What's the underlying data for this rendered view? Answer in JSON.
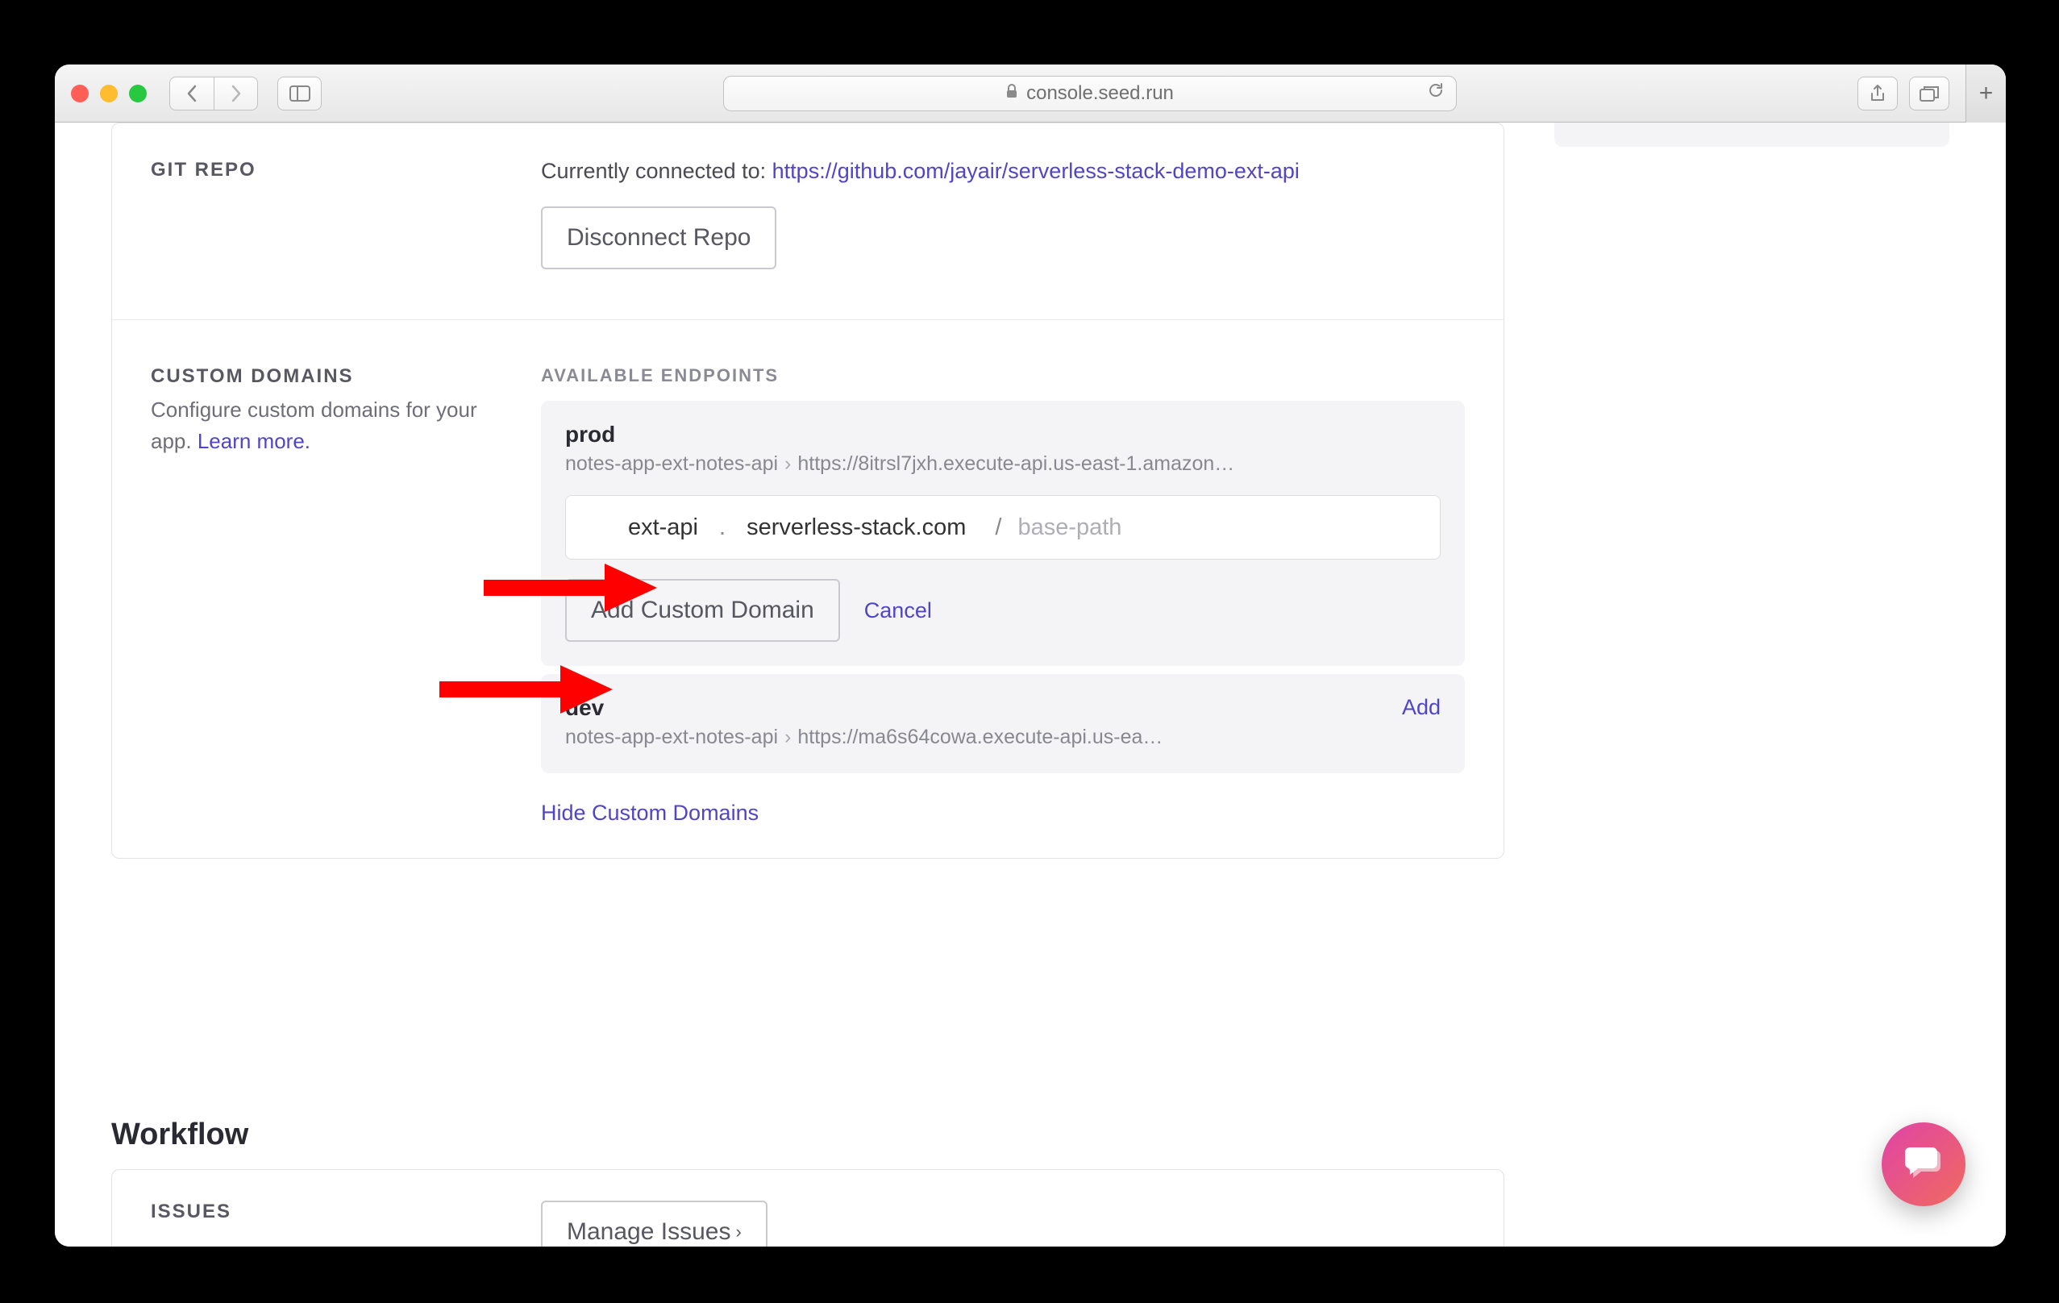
{
  "browser": {
    "url": "console.seed.run"
  },
  "git_repo": {
    "label": "GIT REPO",
    "connected_text": "Currently connected to: ",
    "repo_url": "https://github.com/jayair/serverless-stack-demo-ext-api",
    "disconnect_button": "Disconnect Repo"
  },
  "custom_domains": {
    "label": "CUSTOM DOMAINS",
    "description": "Configure custom domains for your app. ",
    "learn_more": "Learn more.",
    "endpoints_label": "AVAILABLE ENDPOINTS",
    "prod": {
      "name": "prod",
      "stack": "notes-app-ext-notes-api",
      "url": "https://8itrsl7jxh.execute-api.us-east-1.amazon…",
      "subdomain": "ext-api",
      "domain": "serverless-stack.com",
      "base_path_placeholder": "base-path"
    },
    "dev": {
      "name": "dev",
      "stack": "notes-app-ext-notes-api",
      "url": "https://ma6s64cowa.execute-api.us-ea…",
      "add_label": "Add"
    },
    "add_button": "Add Custom Domain",
    "cancel": "Cancel",
    "hide": "Hide Custom Domains"
  },
  "workflow": {
    "heading": "Workflow",
    "issues_label": "ISSUES",
    "manage_button": "Manage Issues"
  }
}
